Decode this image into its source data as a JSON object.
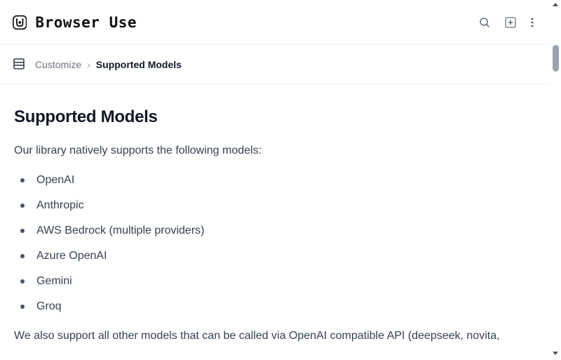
{
  "header": {
    "logo_text": "Browser Use",
    "search_icon": "search-icon",
    "ai_icon": "sparkle-icon",
    "more_icon": "more-vertical-icon"
  },
  "breadcrumb": {
    "parent": "Customize",
    "separator": "›",
    "current": "Supported Models"
  },
  "page": {
    "title": "Supported Models",
    "intro": "Our library natively supports the following models:",
    "models": [
      "OpenAI",
      "Anthropic",
      "AWS Bedrock (multiple providers)",
      "Azure OpenAI",
      "Gemini",
      "Groq"
    ],
    "outro": "We also support all other models that can be called via OpenAI compatible API (deepseek, novita,"
  },
  "colors": {
    "accent": "#111827",
    "text": "#374151",
    "muted": "#6b7280"
  }
}
